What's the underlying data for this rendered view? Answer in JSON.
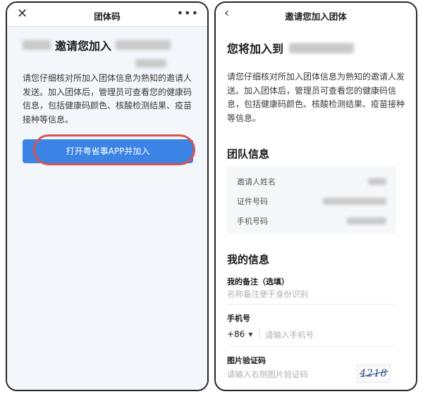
{
  "left_screen": {
    "nav": {
      "close_icon": "close-icon",
      "title": "团体码",
      "more_icon": "more-icon"
    },
    "heading_invite": "邀请您加入",
    "description": "请您仔细核对所加入团体信息为熟知的邀请人发送。加入团体后，管理员可查看您的健康码信息，包括健康码颜色、核酸检测结果、疫苗接种等信息。",
    "open_button": "打开粤省事APP并加入",
    "highlight_color": "#d9534f",
    "button_color": "#3b83e4"
  },
  "right_screen": {
    "nav": {
      "back_icon": "back-icon",
      "title": "邀请您加入团体"
    },
    "heading": "您将加入到",
    "description": "请您仔细核对所加入团体信息为熟知的邀请人发送。加入团体后，管理员可查看您的健康码信息，包括健康码颜色、核酸检测结果、疫苗接种等信息。",
    "team_section_title": "团队信息",
    "team_info": [
      {
        "label": "邀请人姓名"
      },
      {
        "label": "证件号码"
      },
      {
        "label": "手机号码"
      }
    ],
    "my_info_title": "我的信息",
    "remark": {
      "label": "我的备注（选填）",
      "placeholder": "名称备注便于身份识别"
    },
    "phone": {
      "label": "手机号",
      "country_code": "+86",
      "placeholder": "请输入手机号"
    },
    "captcha": {
      "label": "图片验证码",
      "placeholder": "请输入右侧图片验证码",
      "image_text": "4218"
    }
  }
}
